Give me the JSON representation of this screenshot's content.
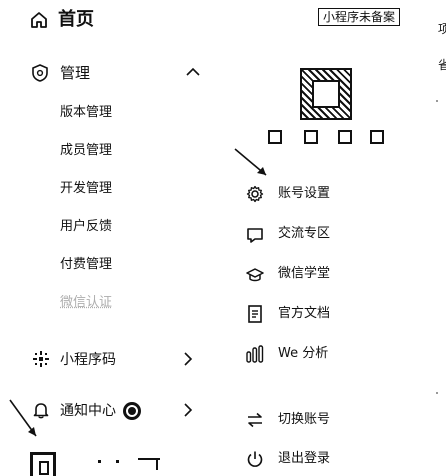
{
  "header": {
    "home_label": "首页",
    "badge": "小程序未备案"
  },
  "nav": {
    "manage_label": "管理",
    "sub_items": [
      "版本管理",
      "成员管理",
      "开发管理",
      "用户反馈",
      "付费管理",
      "微信认证"
    ],
    "qrcode_label": "小程序码",
    "notify_label": "通知中心"
  },
  "menu": {
    "items": [
      {
        "label": "账号设置",
        "icon": "gear-icon"
      },
      {
        "label": "交流专区",
        "icon": "chat-icon"
      },
      {
        "label": "微信学堂",
        "icon": "graduation-cap-icon"
      },
      {
        "label": "官方文档",
        "icon": "document-icon"
      },
      {
        "label": "We 分析",
        "icon": "analytics-icon"
      }
    ],
    "switch_account": "切换账号",
    "logout": "退出登录"
  },
  "edge": {
    "right_top_1": "项",
    "right_top_2": "省"
  },
  "colors": {
    "text": "#111111",
    "muted": "#777777",
    "background": "#ffffff"
  }
}
